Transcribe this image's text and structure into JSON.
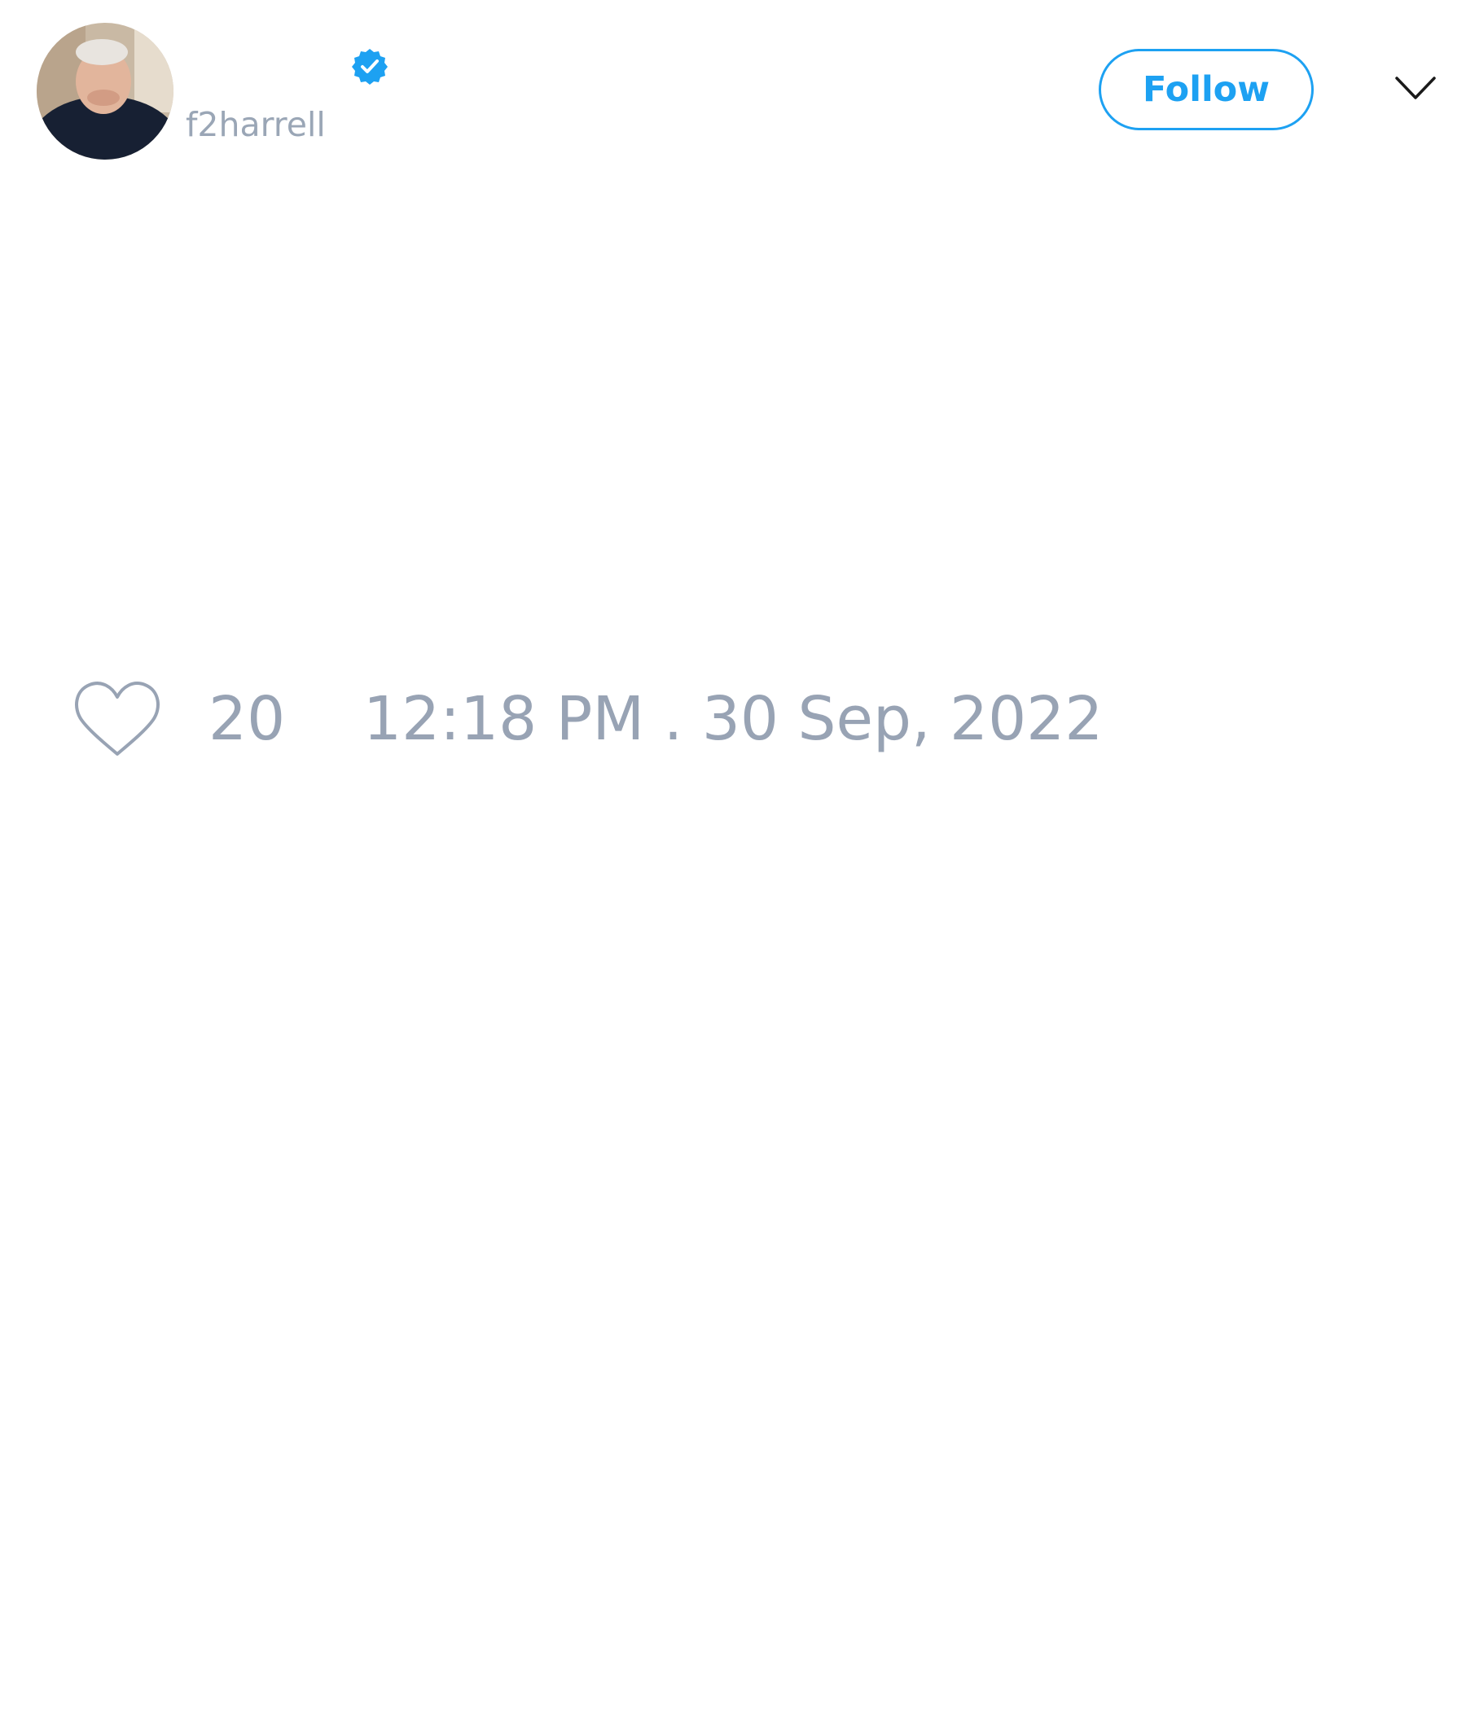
{
  "user": {
    "handle": "f2harrell",
    "verified": true
  },
  "actions": {
    "follow_label": "Follow"
  },
  "stats": {
    "likes": "20",
    "timestamp": "12:18 PM . 30 Sep, 2022"
  },
  "colors": {
    "accent": "#1da1f2",
    "muted_text": "#98a3b4"
  },
  "icons": {
    "verified": "verified-badge-icon",
    "more": "chevron-down-icon",
    "like": "heart-icon"
  }
}
